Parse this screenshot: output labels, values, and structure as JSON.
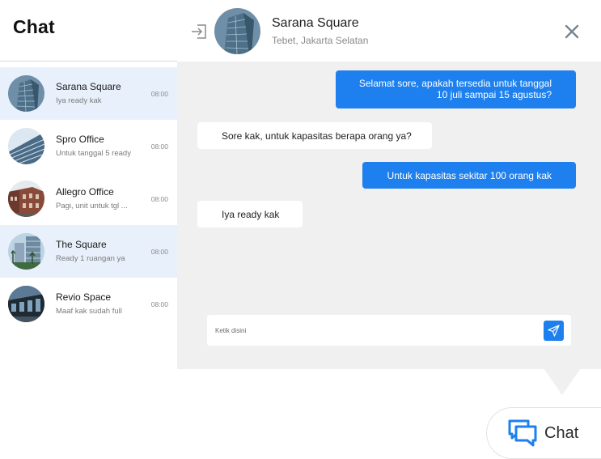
{
  "sidebar": {
    "title": "Chat",
    "chats": [
      {
        "name": "Sarana Square",
        "preview": "Iya ready kak",
        "time": "08:00",
        "active": true
      },
      {
        "name": "Spro Office",
        "preview": "Untuk tanggal 5 ready",
        "time": "08:00",
        "active": false
      },
      {
        "name": "Allegro Office",
        "preview": "Pagi, unit untuk tgl ...",
        "time": "08:00",
        "active": false
      },
      {
        "name": "The Square",
        "preview": "Ready 1 ruangan ya",
        "time": "08:00",
        "active": true
      },
      {
        "name": "Revio Space",
        "preview": "Maaf kak sudah full",
        "time": "08:00",
        "active": false
      }
    ]
  },
  "conversation": {
    "name": "Sarana Square",
    "location": "Tebet, Jakarta Selatan",
    "messages": [
      {
        "direction": "out",
        "line1": "Selamat sore, apakah tersedia untuk tanggal",
        "line2": "10 juli sampai 15 agustus?"
      },
      {
        "direction": "in",
        "text": "Sore kak, untuk kapasitas berapa orang ya?"
      },
      {
        "direction": "out",
        "text": "Untuk kapasitas sekitar 100 orang kak"
      },
      {
        "direction": "in",
        "text": "Iya ready kak"
      }
    ],
    "composer": {
      "placeholder": "Ketik disini",
      "value": ""
    }
  },
  "launcher": {
    "label": "Chat"
  },
  "icons": {
    "exit": "exit-icon",
    "close": "close-icon",
    "send": "send-icon",
    "launcher": "chat-bubbles-icon"
  },
  "colors": {
    "accent": "#1e80ee",
    "active_row": "#e8f1fb",
    "panel_bg": "#f0f0f0"
  }
}
